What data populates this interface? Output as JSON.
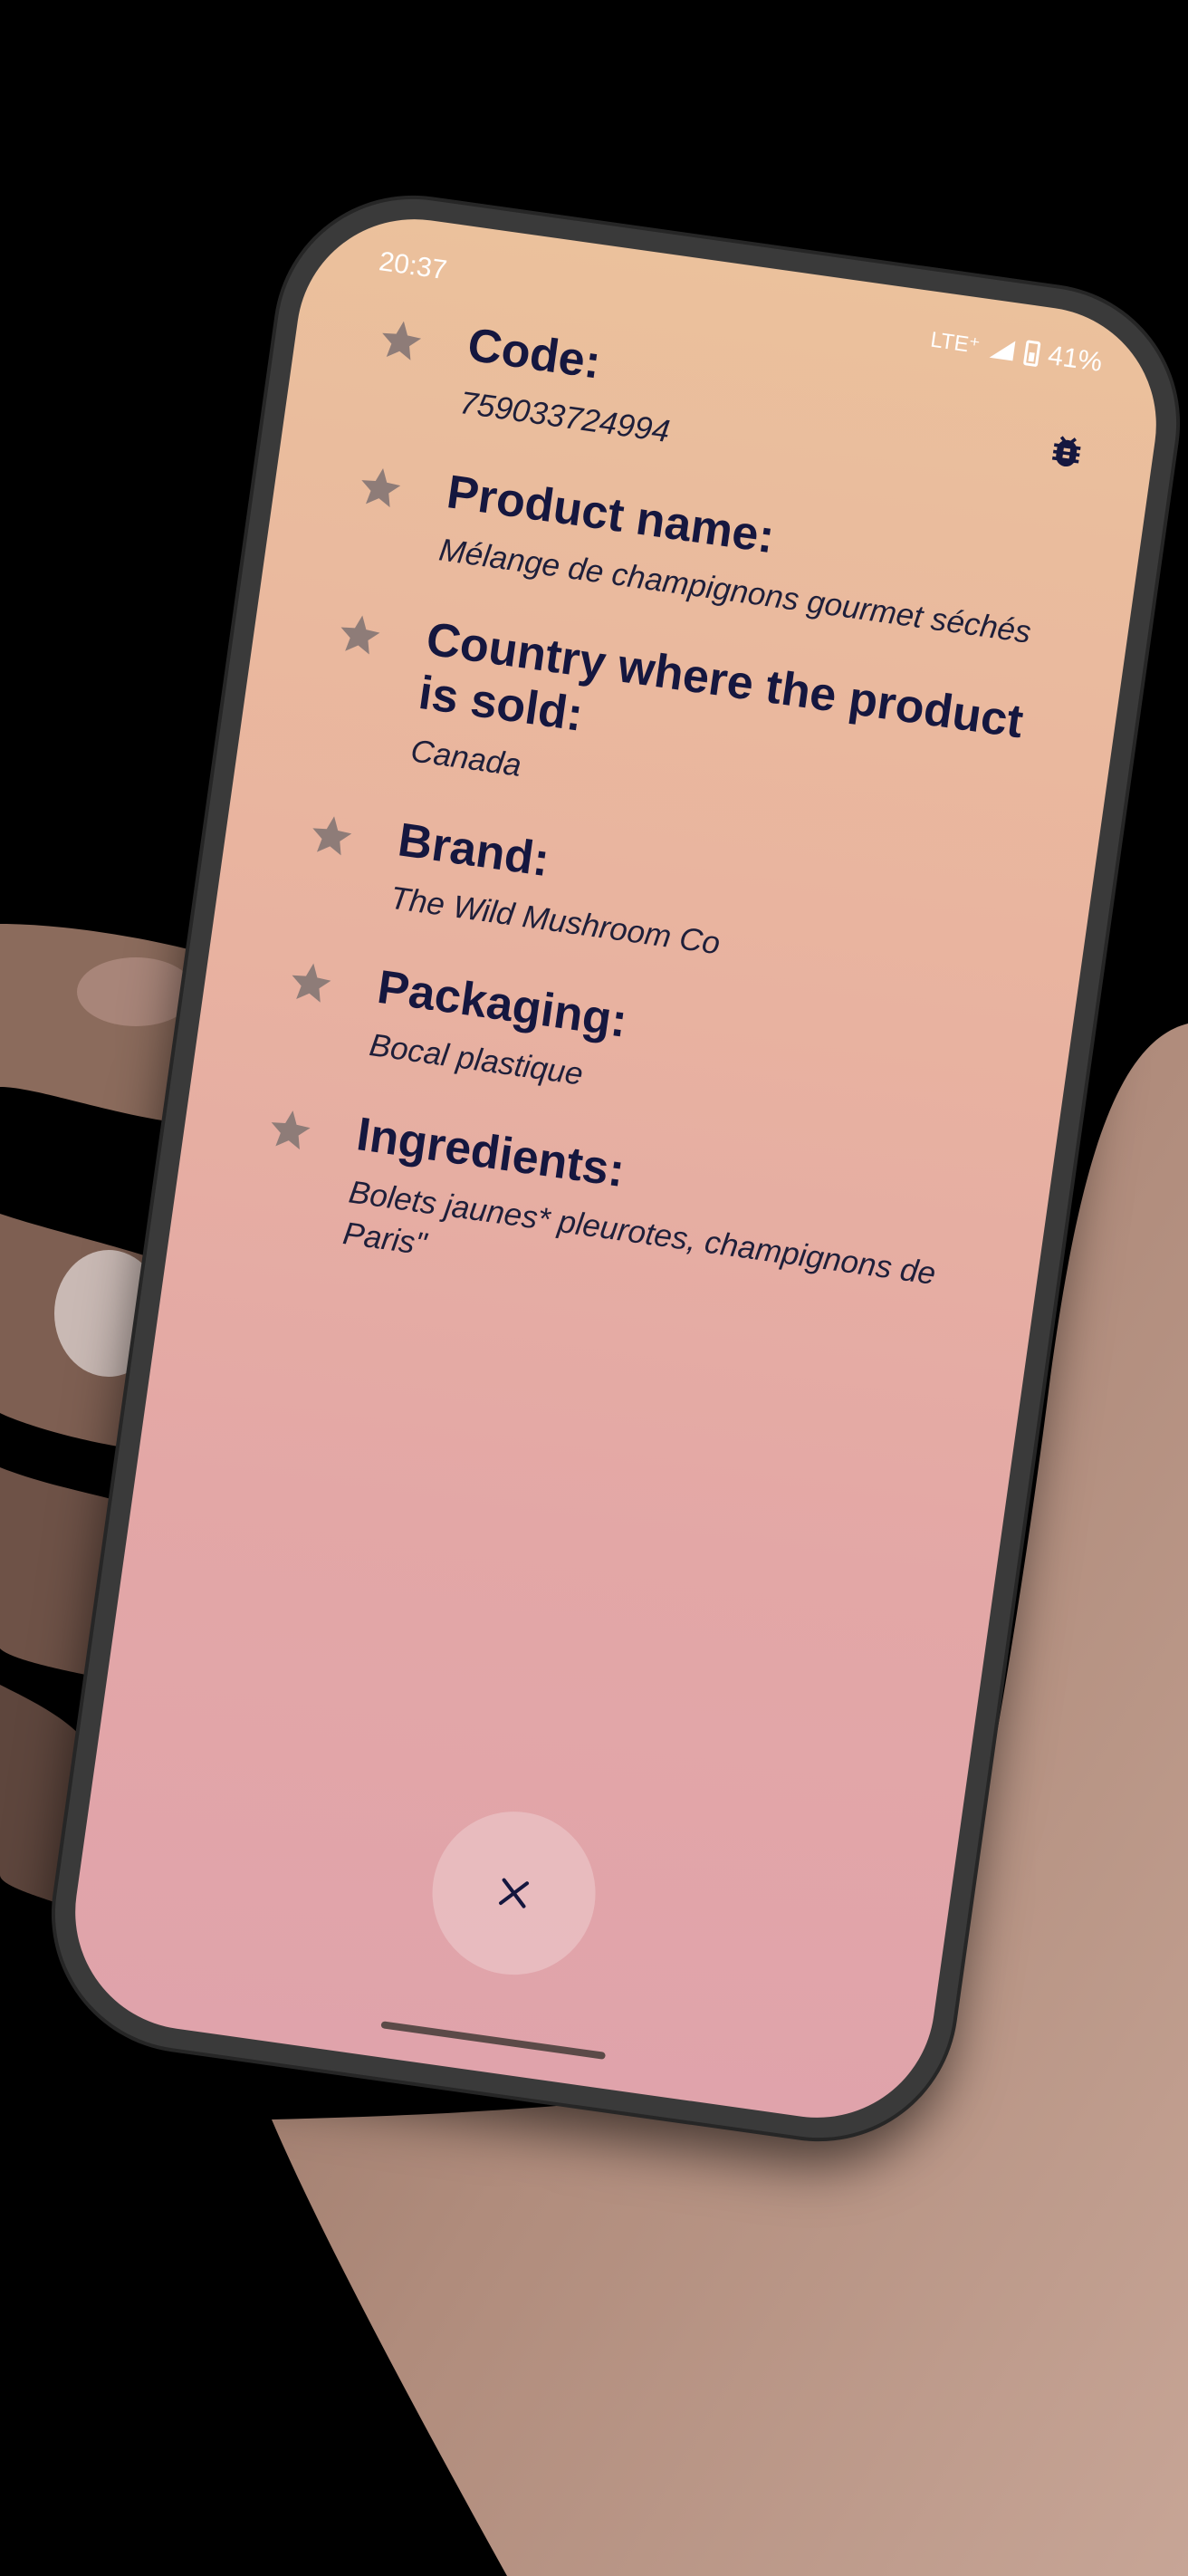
{
  "status_bar": {
    "time": "20:37",
    "network": "LTE⁺",
    "battery": "41%"
  },
  "icons": {
    "debug": "bug-icon",
    "favorite": "star-icon",
    "close": "close-icon"
  },
  "colors": {
    "label": "#15173f",
    "value": "#1e1f3a",
    "star": "#8e7c78",
    "gradient_top": "#ebc19c",
    "gradient_bottom": "#e0a3ab"
  },
  "fields": [
    {
      "label": "Code:",
      "value": "759033724994"
    },
    {
      "label": "Product name:",
      "value": "Mélange de champignons gourmet séchés"
    },
    {
      "label": "Country where the product is sold:",
      "value": "Canada"
    },
    {
      "label": "Brand:",
      "value": "The Wild Mushroom Co"
    },
    {
      "label": "Packaging:",
      "value": "Bocal plastique"
    },
    {
      "label": "Ingredients:",
      "value": "Bolets jaunes* pleurotes, champignons de Paris\""
    }
  ]
}
